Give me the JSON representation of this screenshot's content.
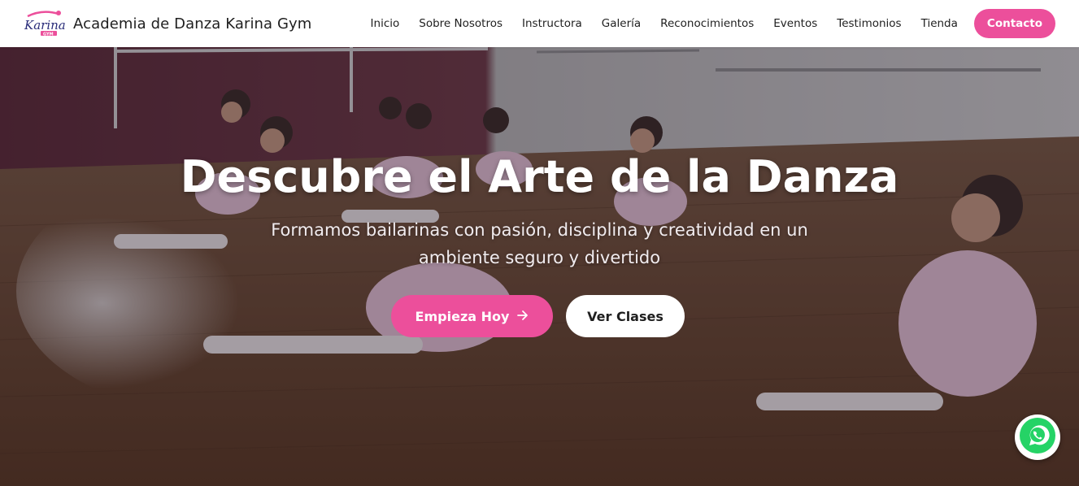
{
  "header": {
    "brand_name": "Academia de Danza Karina Gym",
    "logo_text": "Karina",
    "logo_subtext": "GYM",
    "nav": [
      {
        "label": "Inicio"
      },
      {
        "label": "Sobre Nosotros"
      },
      {
        "label": "Instructora"
      },
      {
        "label": "Galería"
      },
      {
        "label": "Reconocimientos"
      },
      {
        "label": "Eventos"
      },
      {
        "label": "Testimonios"
      },
      {
        "label": "Tienda"
      }
    ],
    "cta_label": "Contacto"
  },
  "hero": {
    "title": "Descubre el Arte de la Danza",
    "subtitle": "Formamos bailarinas con pasión, disciplina y creatividad en un ambiente seguro y divertido",
    "primary_button": "Empieza Hoy",
    "primary_icon": "arrow-right-icon",
    "secondary_button": "Ver Clases",
    "background_image": "ballet-class-photo"
  },
  "floating": {
    "whatsapp_icon": "whatsapp-icon"
  },
  "colors": {
    "accent": "#ec4f9b",
    "text_dark": "#1f1f1f",
    "white": "#ffffff",
    "whatsapp_green": "#25d366"
  }
}
